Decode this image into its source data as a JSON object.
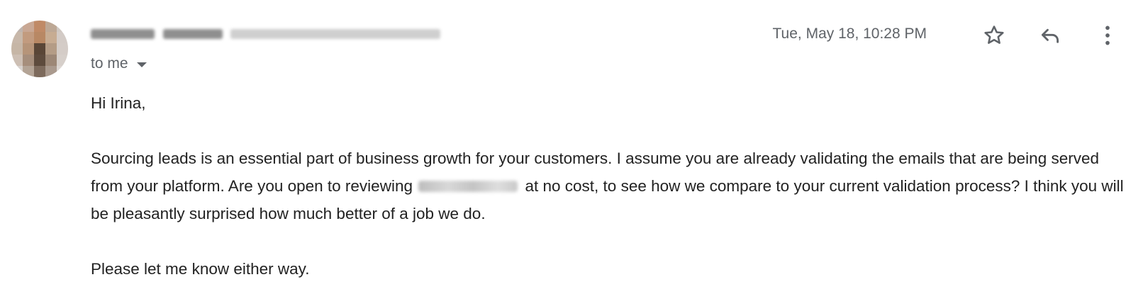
{
  "sender": {
    "name_redacted": true,
    "email_redacted": true
  },
  "recipient": {
    "label": "to me"
  },
  "date": "Tue, May 18, 10:28 PM",
  "actions": {
    "star_icon": "star-outline-icon",
    "reply_icon": "reply-icon",
    "more_icon": "more-vertical-icon"
  },
  "body": {
    "greeting": "Hi Irina,",
    "paragraph1_before": "Sourcing leads is an essential part of business growth for your customers. I assume you are already validating the emails that are being served from your platform. Are you open to reviewing",
    "paragraph1_after": "at no cost, to see how we compare to your current validation process? I think you will be pleasantly surprised how much better of a job we do.",
    "paragraph2": "Please let me know either way."
  },
  "colors": {
    "muted_text": "#5f6368",
    "body_text": "#222222",
    "icon": "#5f6368"
  }
}
